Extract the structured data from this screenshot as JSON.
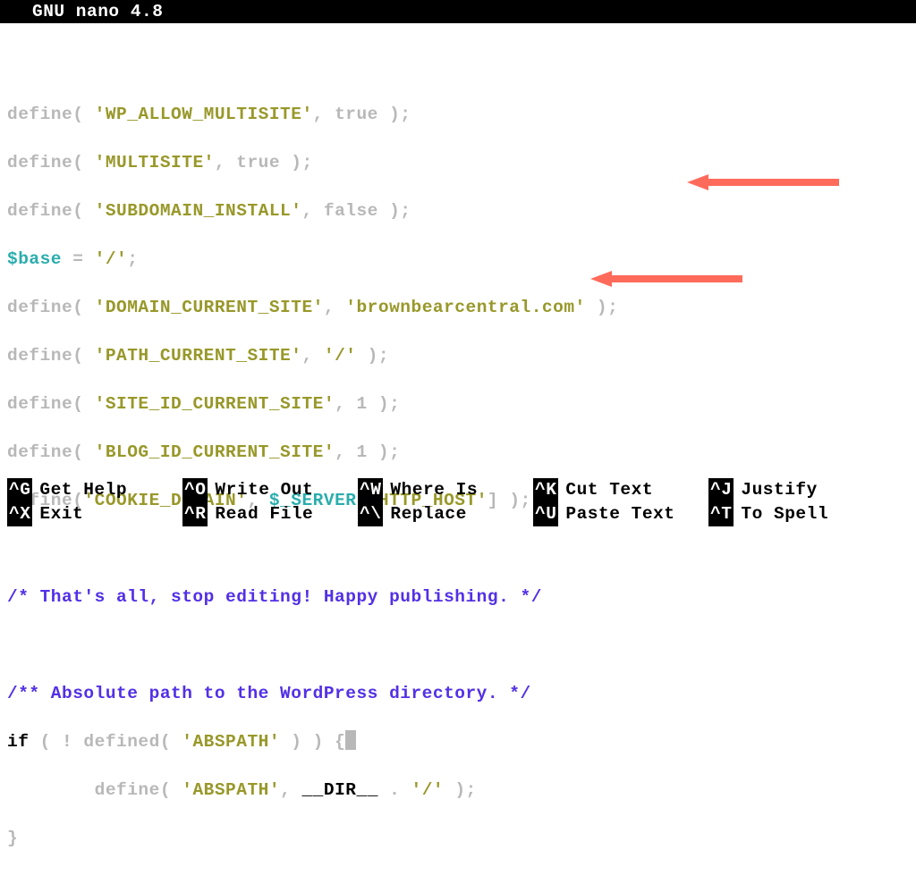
{
  "title": "GNU nano 4.8",
  "code": {
    "l1": {
      "define": "define(",
      "sp": " ",
      "const": "'WP_ALLOW_MULTISITE'",
      "comma": ", true );"
    },
    "l2": {
      "define": "define(",
      "sp": " ",
      "const": "'MULTISITE'",
      "comma": ", true );"
    },
    "l3": {
      "define": "define(",
      "sp": " ",
      "const": "'SUBDOMAIN_INSTALL'",
      "comma": ", false );"
    },
    "l4": {
      "var": "$base",
      "assign": " = ",
      "val": "'/'",
      "semi": ";"
    },
    "l5": {
      "define": "define(",
      "sp": " ",
      "const": "'DOMAIN_CURRENT_SITE'",
      "comma": ", ",
      "val": "'brownbearcentral.com'",
      "end": " );"
    },
    "l6": {
      "define": "define(",
      "sp": " ",
      "const": "'PATH_CURRENT_SITE'",
      "comma": ", ",
      "val": "'/'",
      "end": " );"
    },
    "l7": {
      "define": "define(",
      "sp": " ",
      "const": "'SITE_ID_CURRENT_SITE'",
      "comma": ", 1 );"
    },
    "l8": {
      "define": "define(",
      "sp": " ",
      "const": "'BLOG_ID_CURRENT_SITE'",
      "comma": ", 1 );"
    },
    "l9": {
      "define": "define(",
      "const": "'COOKIE_DOMAIN'",
      "comma": ", ",
      "srv": "$_SERVER",
      "br1": "[",
      "host": "'HTTP_HOST'",
      "br2": "]",
      "end": " );"
    },
    "c1": "/* That's all, stop editing! Happy publishing. */",
    "c2": "/** Absolute path to the WordPress directory. */",
    "l10": {
      "if": "if",
      "p1": " ( ! ",
      "def": "defined(",
      "sp": " ",
      "abs": "'ABSPATH'",
      "p2": " ) ) {"
    },
    "l11": {
      "indent": "        ",
      "def": "define(",
      "sp": " ",
      "abs": "'ABSPATH'",
      "comma": ", ",
      "dir": "__DIR__",
      "dot": " . ",
      "val": "'/'",
      "end": " );"
    },
    "l12": "}"
  },
  "shortcuts": {
    "r1": [
      {
        "key": "^G",
        "label": "Get Help"
      },
      {
        "key": "^O",
        "label": "Write Out"
      },
      {
        "key": "^W",
        "label": "Where Is"
      },
      {
        "key": "^K",
        "label": "Cut Text"
      },
      {
        "key": "^J",
        "label": "Justify"
      }
    ],
    "r2": [
      {
        "key": "^X",
        "label": "Exit"
      },
      {
        "key": "^R",
        "label": "Read File"
      },
      {
        "key": "^\\",
        "label": "Replace"
      },
      {
        "key": "^U",
        "label": "Paste Text"
      },
      {
        "key": "^T",
        "label": "To Spell"
      }
    ]
  },
  "arrow_color": "#ff6b5b"
}
